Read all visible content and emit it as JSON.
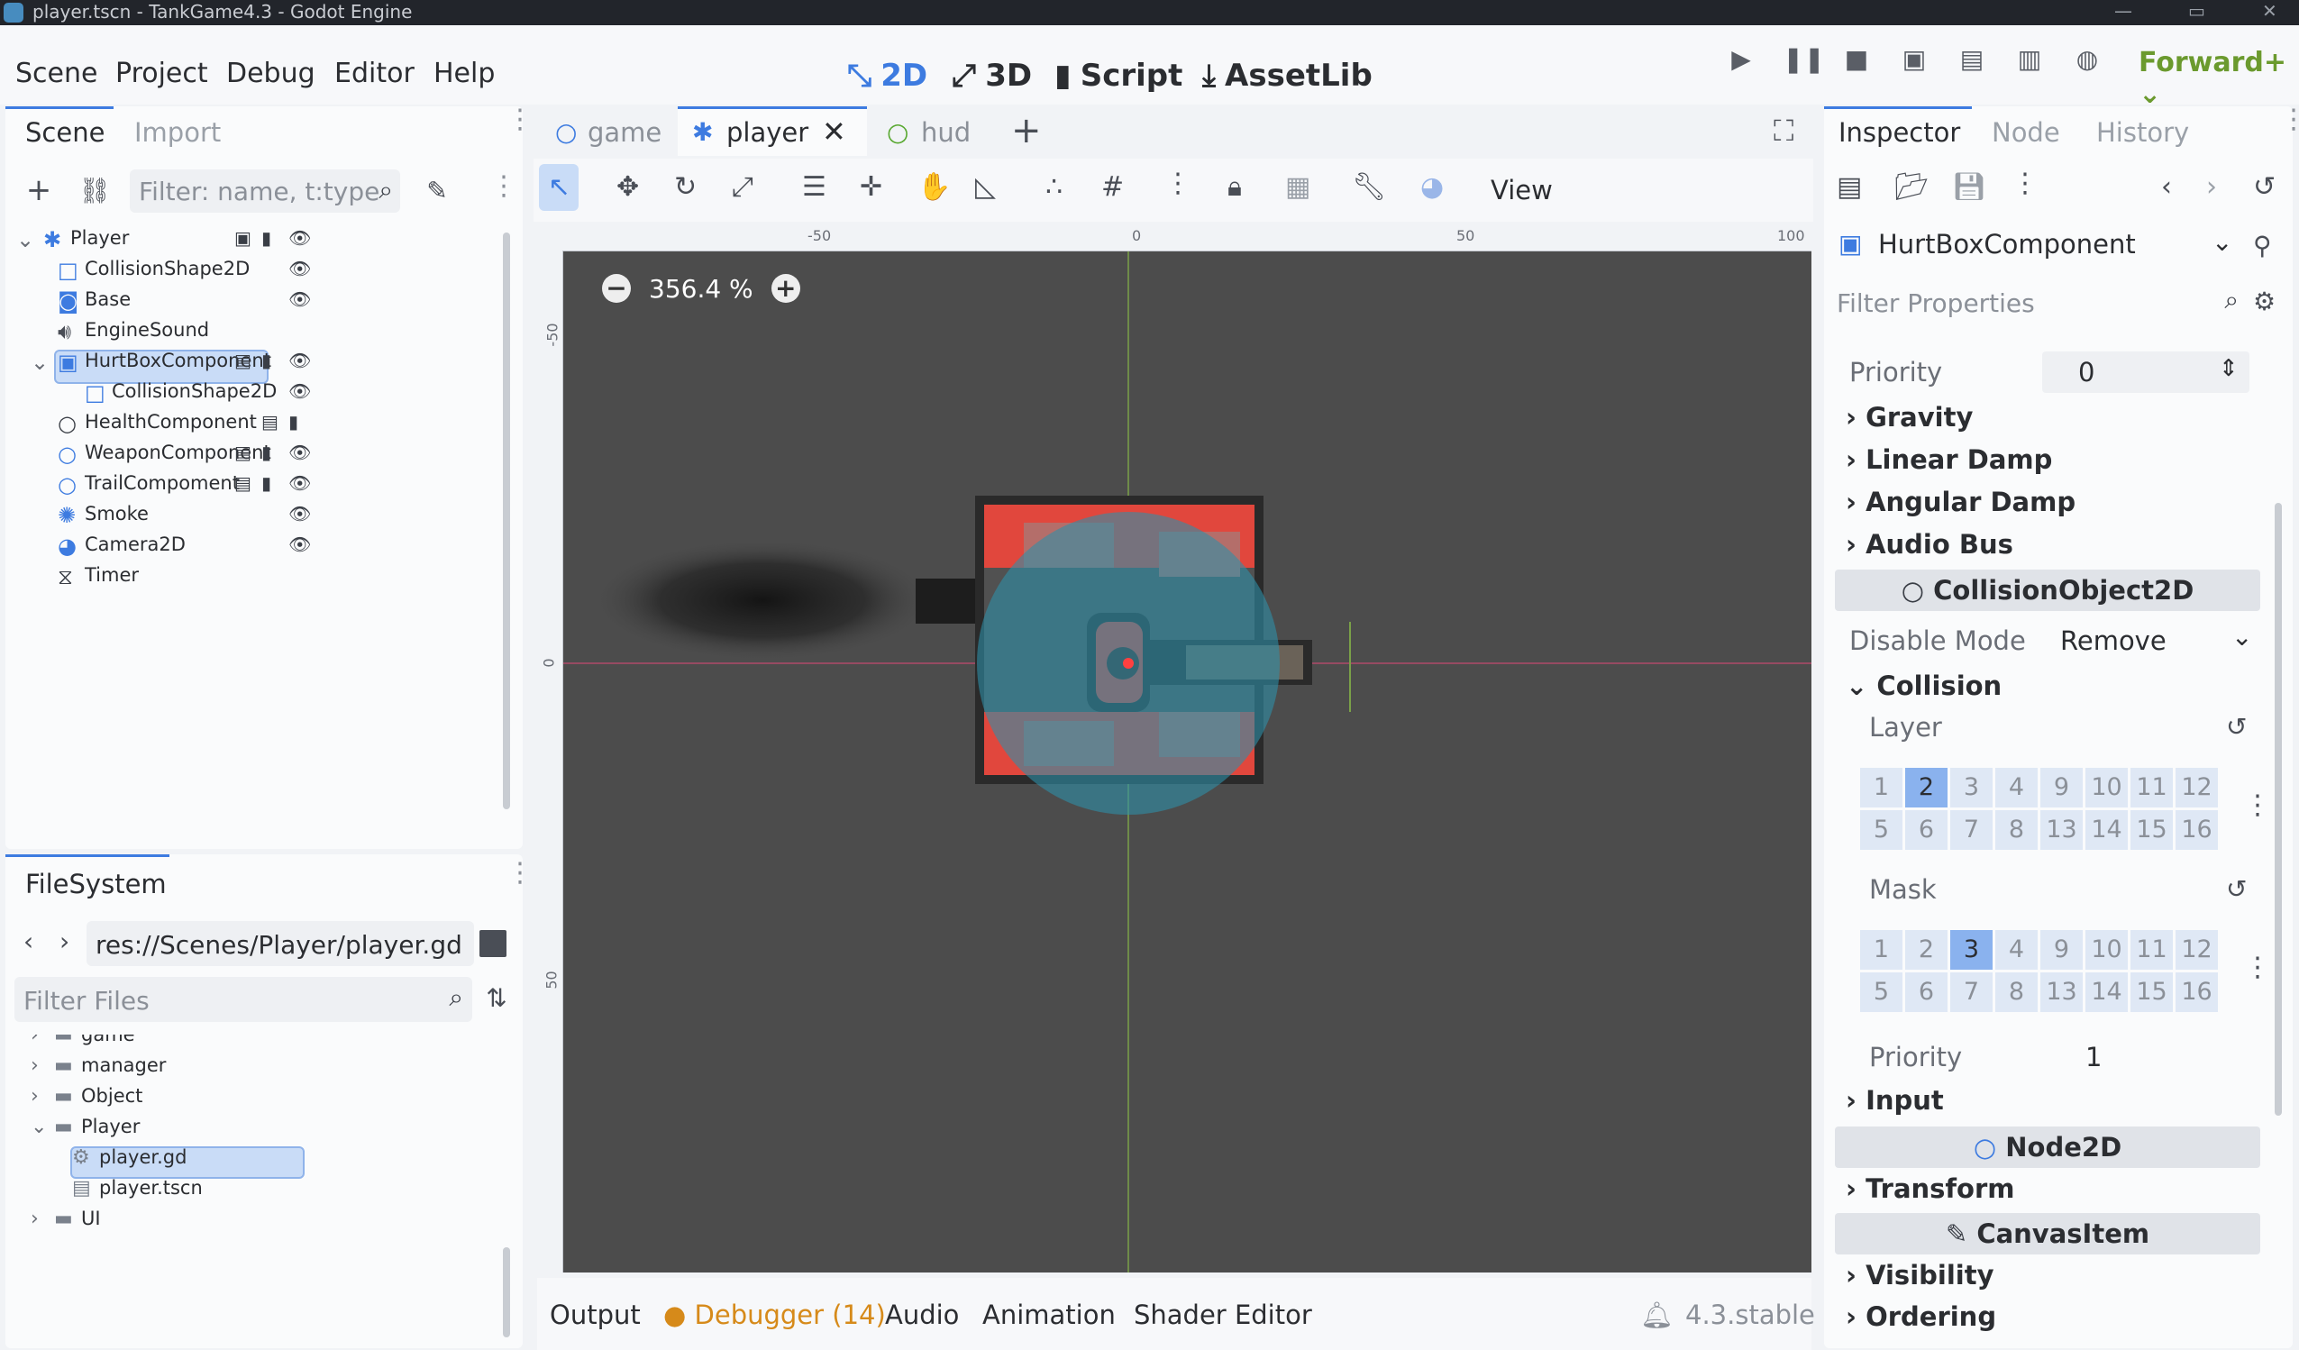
{
  "window": {
    "title": "player.tscn - TankGame4.3 - Godot Engine"
  },
  "menu": {
    "items": [
      "Scene",
      "Project",
      "Debug",
      "Editor",
      "Help"
    ]
  },
  "workspaces": {
    "items": [
      "2D",
      "3D",
      "Script",
      "AssetLib"
    ],
    "active": "2D"
  },
  "renderer": "Forward+",
  "scene_dock": {
    "tabs": [
      "Scene",
      "Import"
    ],
    "filter_placeholder": "Filter: name, t:type",
    "nodes": [
      {
        "label": "Player",
        "icon": "player-node-icon",
        "depth": 0
      },
      {
        "label": "CollisionShape2D",
        "icon": "collision-shape-icon",
        "depth": 1
      },
      {
        "label": "Base",
        "icon": "sprite-icon",
        "depth": 1
      },
      {
        "label": "EngineSound",
        "icon": "audio-icon",
        "depth": 1
      },
      {
        "label": "HurtBoxComponent",
        "icon": "area-icon",
        "depth": 1,
        "selected": true
      },
      {
        "label": "CollisionShape2D",
        "icon": "collision-shape-icon",
        "depth": 2
      },
      {
        "label": "HealthComponent",
        "icon": "node-icon",
        "depth": 1
      },
      {
        "label": "WeaponComponent",
        "icon": "node2d-icon",
        "depth": 1
      },
      {
        "label": "TrailCompoment",
        "icon": "node2d-icon",
        "depth": 1
      },
      {
        "label": "Smoke",
        "icon": "particles-icon",
        "depth": 1
      },
      {
        "label": "Camera2D",
        "icon": "camera-icon",
        "depth": 1
      },
      {
        "label": "Timer",
        "icon": "timer-icon",
        "depth": 1
      }
    ]
  },
  "filesystem": {
    "tab": "FileSystem",
    "path": "res://Scenes/Player/player.gd",
    "filter_placeholder": "Filter Files",
    "items": [
      {
        "label": "game",
        "type": "folder"
      },
      {
        "label": "manager",
        "type": "folder"
      },
      {
        "label": "Object",
        "type": "folder"
      },
      {
        "label": "Player",
        "type": "folder"
      },
      {
        "label": "player.gd",
        "type": "script",
        "selected": true
      },
      {
        "label": "player.tscn",
        "type": "scene"
      },
      {
        "label": "UI",
        "type": "folder"
      }
    ]
  },
  "editor_tabs": [
    {
      "label": "game",
      "icon": "node-icon"
    },
    {
      "label": "player",
      "icon": "player-node-icon",
      "active": true
    },
    {
      "label": "hud",
      "icon": "control-icon"
    }
  ],
  "toolbar": {
    "view_label": "View"
  },
  "viewport": {
    "zoom": "356.4 %",
    "ruler_top": [
      "-50",
      "0",
      "50",
      "100"
    ],
    "ruler_left": [
      "-50",
      "0",
      "50"
    ]
  },
  "bottom_panel": {
    "tabs": [
      "Output",
      "Debugger (14)",
      "Audio",
      "Animation",
      "Shader Editor"
    ],
    "version": "4.3.stable"
  },
  "inspector": {
    "tabs": [
      "Inspector",
      "Node",
      "History"
    ],
    "object": "HurtBoxComponent",
    "filter_placeholder": "Filter Properties",
    "priority_label": "Priority",
    "priority_value": "0",
    "groups_top": [
      "Gravity",
      "Linear Damp",
      "Angular Damp",
      "Audio Bus"
    ],
    "section_collision": "CollisionObject2D",
    "disable_mode_label": "Disable Mode",
    "disable_mode_value": "Remove",
    "collision_group": "Collision",
    "layer_label": "Layer",
    "mask_label": "Mask",
    "layer_cells": [
      "1",
      "2",
      "3",
      "4",
      "9",
      "10",
      "11",
      "12",
      "5",
      "6",
      "7",
      "8",
      "13",
      "14",
      "15",
      "16"
    ],
    "layer_on": "2",
    "mask_on": "3",
    "priority2_label": "Priority",
    "priority2_value": "1",
    "input_group": "Input",
    "section_node2d": "Node2D",
    "transform_group": "Transform",
    "section_canvasitem": "CanvasItem",
    "visibility_group": "Visibility",
    "ordering_group": "Ordering"
  },
  "colors": {
    "accent": "#3d7be0",
    "renderer": "#6b9a2e",
    "debugger": "#d68a1a",
    "viewport_bg": "#4c4c4c"
  }
}
